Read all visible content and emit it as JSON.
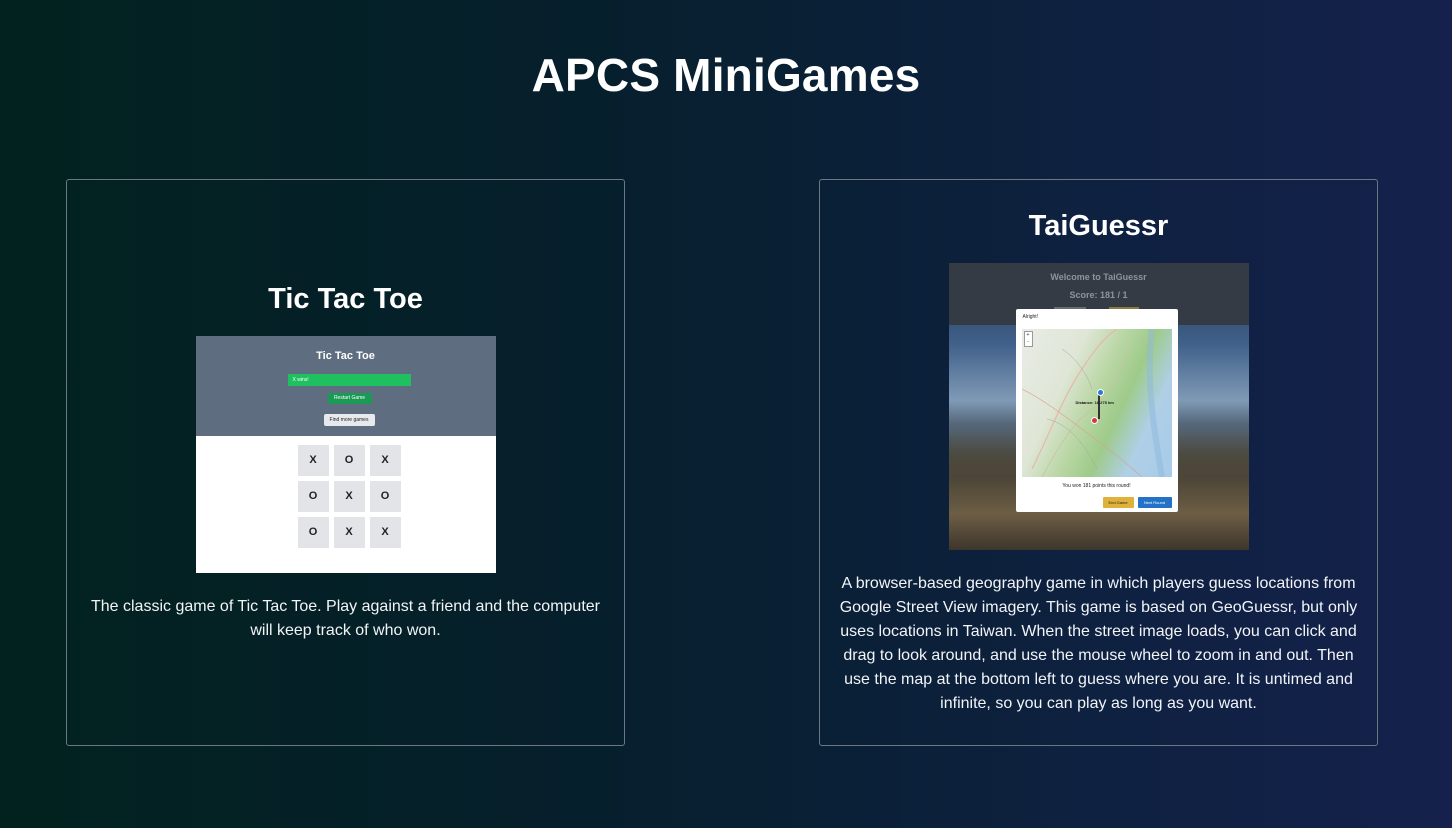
{
  "page": {
    "title": "APCS MiniGames"
  },
  "games": [
    {
      "title": "Tic Tac Toe",
      "description": "The classic game of Tic Tac Toe. Play against a friend and the computer will keep track of who won.",
      "preview": {
        "title": "Tic Tac Toe",
        "status": "X wins!",
        "restart_label": "Restart Game",
        "more_label": "Find more games",
        "board": [
          "X",
          "O",
          "X",
          "O",
          "X",
          "O",
          "O",
          "X",
          "X"
        ]
      }
    },
    {
      "title": "TaiGuessr",
      "description": "A browser-based geography game in which players guess locations from Google Street View imagery. This game is based on GeoGuessr, but only uses locations in Taiwan. When the street image loads, you can click and drag to look around, and use the mouse wheel to zoom in and out. Then use the map at the bottom left to guess where you are. It is untimed and infinite, so you can play as long as you want.",
      "preview": {
        "welcome": "Welcome to TaiGuessr",
        "score": "Score: 181 / 1",
        "modal_header": "Alright!",
        "distance": "Distance: 16.275 km",
        "result": "You won 181 points this round!",
        "end_label": "End Game",
        "next_label": "Next Round",
        "zoom_in": "+",
        "zoom_out": "-"
      }
    }
  ]
}
